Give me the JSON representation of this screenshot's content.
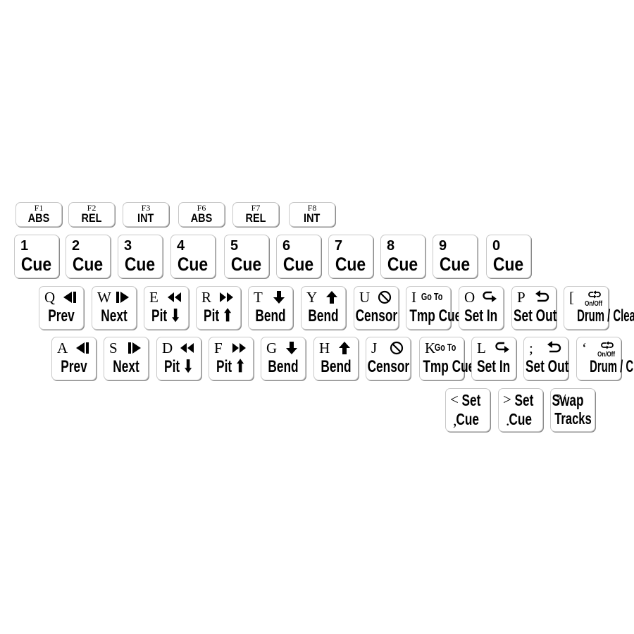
{
  "function_keys": [
    {
      "name": "F1",
      "value": "ABS"
    },
    {
      "name": "F2",
      "value": "REL"
    },
    {
      "name": "F3",
      "value": "INT"
    },
    {
      "name": "F6",
      "value": "ABS"
    },
    {
      "name": "F7",
      "value": "REL"
    },
    {
      "name": "F8",
      "value": "INT"
    }
  ],
  "number_keys": [
    {
      "num": "1",
      "label": "Cue"
    },
    {
      "num": "2",
      "label": "Cue"
    },
    {
      "num": "3",
      "label": "Cue"
    },
    {
      "num": "4",
      "label": "Cue"
    },
    {
      "num": "5",
      "label": "Cue"
    },
    {
      "num": "6",
      "label": "Cue"
    },
    {
      "num": "7",
      "label": "Cue"
    },
    {
      "num": "8",
      "label": "Cue"
    },
    {
      "num": "9",
      "label": "Cue"
    },
    {
      "num": "0",
      "label": "Cue"
    }
  ],
  "top_row": [
    {
      "letter": "Q",
      "icon": "prev-icon",
      "label": "Prev"
    },
    {
      "letter": "W",
      "icon": "next-icon",
      "label": "Next"
    },
    {
      "letter": "E",
      "icon": "rewind-icon",
      "label": "Pit ⬇"
    },
    {
      "letter": "R",
      "icon": "fast-forward-icon",
      "label": "Pit ⬆"
    },
    {
      "letter": "T",
      "icon": "arrow-down-icon",
      "label": "Bend"
    },
    {
      "letter": "Y",
      "icon": "arrow-up-icon",
      "label": "Bend"
    },
    {
      "letter": "U",
      "icon": "censor-icon",
      "label": "Censor"
    },
    {
      "letter": "I",
      "top_text": "Go To",
      "label": "Tmp Cue"
    },
    {
      "letter": "O",
      "icon": "loop-in-icon",
      "label": "Set In"
    },
    {
      "letter": "P",
      "icon": "loop-out-icon",
      "label": "Set Out"
    },
    {
      "letter": "[",
      "icon": "swap-loop-icon",
      "sub_text": "On/Off",
      "label": "Drum / Clean"
    }
  ],
  "home_row": [
    {
      "letter": "A",
      "icon": "prev-icon",
      "label": "Prev"
    },
    {
      "letter": "S",
      "icon": "next-icon",
      "label": "Next"
    },
    {
      "letter": "D",
      "icon": "rewind-icon",
      "label": "Pit ⬇"
    },
    {
      "letter": "F",
      "icon": "fast-forward-icon",
      "label": "Pit ⬆"
    },
    {
      "letter": "G",
      "icon": "arrow-down-icon",
      "label": "Bend"
    },
    {
      "letter": "H",
      "icon": "arrow-up-icon",
      "label": "Bend"
    },
    {
      "letter": "J",
      "icon": "censor-icon",
      "label": "Censor"
    },
    {
      "letter": "K",
      "top_text": "Go To",
      "label": "Tmp Cue"
    },
    {
      "letter": "L",
      "icon": "loop-in-icon",
      "label": "Set In"
    },
    {
      "letter": ";",
      "icon": "loop-out-icon",
      "label": "Set Out"
    },
    {
      "letter": "‘",
      "icon": "swap-loop-icon",
      "sub_text": "On/Off",
      "label": "Drum / Clean"
    }
  ],
  "bottom_row": [
    {
      "top_left": "<",
      "top_right": "Set",
      "bottom_left": ",",
      "bottom_right": "Cue"
    },
    {
      "top_left": ">",
      "top_right": "Set",
      "bottom_left": ".",
      "bottom_right": "Cue"
    },
    {
      "top_left": "?/",
      "top_right": "Swap",
      "label": "Tracks"
    }
  ]
}
